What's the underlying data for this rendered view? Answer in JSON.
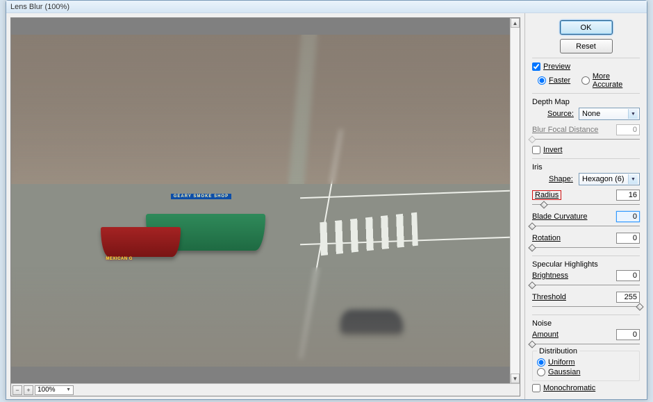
{
  "title": "Lens Blur (100%)",
  "zoom_value": "100%",
  "buttons": {
    "ok": "OK",
    "reset": "Reset"
  },
  "preview": {
    "checkbox_label": "Preview",
    "checked": true,
    "faster_label": "Faster",
    "faster_selected": true,
    "more_accurate_label": "More Accurate"
  },
  "depth_map": {
    "title": "Depth Map",
    "source_label": "Source:",
    "source_value": "None",
    "bfd_label": "Blur Focal Distance",
    "bfd_value": "0",
    "invert_label": "Invert",
    "invert_checked": false
  },
  "iris": {
    "title": "Iris",
    "shape_label": "Shape:",
    "shape_value": "Hexagon (6)",
    "radius_label": "Radius",
    "radius_value": "16",
    "radius_pct": 11,
    "blade_label": "Blade Curvature",
    "blade_value": "0",
    "rotation_label": "Rotation",
    "rotation_value": "0"
  },
  "specular": {
    "title": "Specular Highlights",
    "brightness_label": "Brightness",
    "brightness_value": "0",
    "threshold_label": "Threshold",
    "threshold_value": "255"
  },
  "noise": {
    "title": "Noise",
    "amount_label": "Amount",
    "amount_value": "0",
    "distribution_title": "Distribution",
    "uniform_label": "Uniform",
    "gaussian_label": "Gaussian",
    "mono_label": "Monochromatic"
  },
  "photo": {
    "sign_blue": "GEARY SMOKE SHOP",
    "sign_yellow": "MEXICAN G"
  }
}
